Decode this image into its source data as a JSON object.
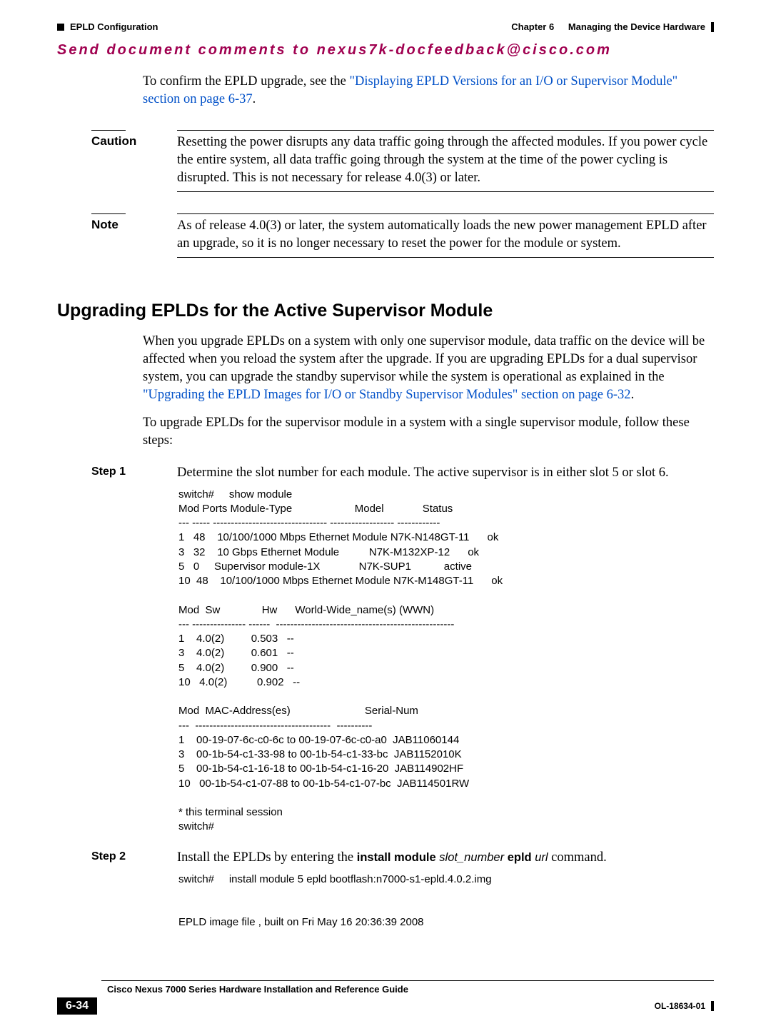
{
  "header": {
    "section_marker": "EPLD Configuration",
    "chapter_label": "Chapter 6",
    "chapter_title": "Managing the Device Hardware"
  },
  "feedback_banner": "Send document comments to nexus7k-docfeedback@cisco.com",
  "intro_para_prefix": "To confirm the EPLD upgrade, see the ",
  "intro_para_link": "\"Displaying EPLD Versions for an I/O or Supervisor Module\" section on page 6-37",
  "intro_para_suffix": ".",
  "caution": {
    "label": "Caution",
    "text": "Resetting the power disrupts any data traffic going through the affected modules. If you power cycle the entire system, all data traffic going through the system at the time of the power cycling is disrupted. This is not necessary for release 4.0(3) or later."
  },
  "note": {
    "label": "Note",
    "text": "As of release 4.0(3) or later, the system automatically loads the new power management EPLD after an upgrade, so it is no longer necessary to reset the power for the module or system."
  },
  "heading": "Upgrading EPLDs for the Active Supervisor Module",
  "para1_prefix": "When you upgrade EPLDs on a system with only one supervisor module, data traffic on the device will be affected when you reload the system after the upgrade. If you are upgrading EPLDs for a dual supervisor system, you can upgrade the standby supervisor while the system is operational as explained in the ",
  "para1_link": "\"Upgrading the EPLD Images for I/O or Standby Supervisor Modules\" section on page 6-32",
  "para1_suffix": ".",
  "para2": "To upgrade EPLDs for the supervisor module in a system with a single supervisor module, follow these steps:",
  "step1": {
    "label": "Step 1",
    "text": "Determine the slot number for each module. The active supervisor is in either slot 5 or slot 6.",
    "cli": "switch#     show module\nMod Ports Module-Type                     Model             Status\n--- ----- -------------------------------- ------------------ ------------\n1   48    10/100/1000 Mbps Ethernet Module N7K-N148GT-11      ok\n3   32    10 Gbps Ethernet Module          N7K-M132XP-12      ok\n5   0     Supervisor module-1X             N7K-SUP1           active\n10  48    10/100/1000 Mbps Ethernet Module N7K-M148GT-11      ok\n\nMod  Sw              Hw      World-Wide_name(s) (WWN)\n--- --------------- ------  --------------------------------------------------\n1    4.0(2)         0.503   --\n3    4.0(2)         0.601   --\n5    4.0(2)         0.900   --\n10   4.0(2)          0.902   --\n\nMod  MAC-Address(es)                         Serial-Num\n---  --------------------------------------  ----------\n1    00-19-07-6c-c0-6c to 00-19-07-6c-c0-a0  JAB11060144\n3    00-1b-54-c1-33-98 to 00-1b-54-c1-33-bc  JAB1152010K\n5    00-1b-54-c1-16-18 to 00-1b-54-c1-16-20  JAB114902HF\n10   00-1b-54-c1-07-88 to 00-1b-54-c1-07-bc  JAB114501RW\n\n* this terminal session\nswitch#"
  },
  "step2": {
    "label": "Step 2",
    "text_prefix": "Install the EPLDs by entering the ",
    "cmd_bold": "install module ",
    "cmd_italic1": "slot_number",
    "cmd_bold2": " epld ",
    "cmd_italic2": "url",
    "text_suffix": " command.",
    "cli": "switch#     install module 5 epld bootflash:n7000-s1-epld.4.0.2.img\n\n\nEPLD image file , built on Fri May 16 20:36:39 2008"
  },
  "footer": {
    "doc_title": "Cisco Nexus 7000 Series Hardware Installation and Reference Guide",
    "page_num": "6-34",
    "doc_id": "OL-18634-01"
  }
}
